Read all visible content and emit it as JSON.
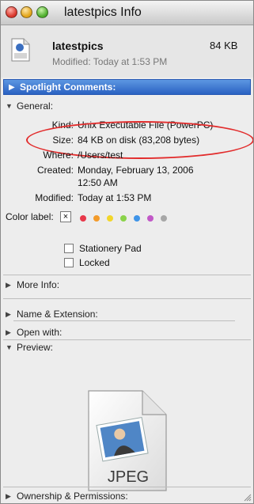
{
  "window": {
    "title": "latestpics Info"
  },
  "header": {
    "file_name": "latestpics",
    "size": "84 KB",
    "modified": "Modified: Today at 1:53 PM"
  },
  "spotlight": {
    "label": "Spotlight Comments:"
  },
  "general": {
    "label": "General:",
    "kind_label": "Kind:",
    "kind_value": "Unix Executable File (PowerPC)",
    "size_label": "Size:",
    "size_value": "84 KB on disk (83,208 bytes)",
    "where_label": "Where:",
    "where_value": "/Users/test",
    "created_label": "Created:",
    "created_value_1": "Monday, February 13, 2006",
    "created_value_2": "12:50 AM",
    "modified_label": "Modified:",
    "modified_value": "Today at 1:53 PM",
    "color_label": "Color label:",
    "colors": [
      "#e8384a",
      "#f39b2b",
      "#f2d62a",
      "#8ad34a",
      "#3f94e8",
      "#c158c7",
      "#a7a7a7"
    ],
    "stationery_label": "Stationery Pad",
    "locked_label": "Locked"
  },
  "sections": {
    "more_info": "More Info:",
    "name_ext": "Name & Extension:",
    "open_with": "Open with:",
    "preview": "Preview:",
    "ownership": "Ownership & Permissions:"
  },
  "preview": {
    "badge": "JPEG"
  },
  "accent": "#2a62c2"
}
